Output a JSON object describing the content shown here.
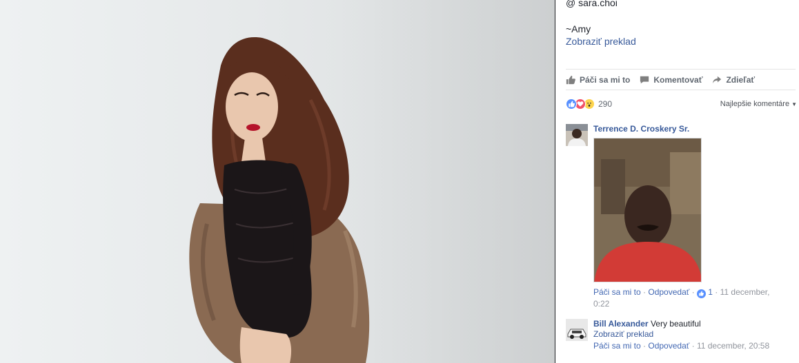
{
  "photo": {
    "icon": "portrait-photo",
    "colors": {
      "backdrop": "#e8ebec",
      "hair": "#5a2e1e",
      "dress": "#1b1618",
      "fur": "#8a6a52",
      "lips": "#b5132a",
      "skin": "#e9c7ae"
    }
  },
  "caption": {
    "mention": "@ sara.choi",
    "signature": "~Amy",
    "translate": "Zobraziť preklad"
  },
  "actions": {
    "like": "Páči sa mi to",
    "comment": "Komentovať",
    "share": "Zdieľať"
  },
  "reactions": {
    "count": "290",
    "types": [
      "like",
      "love",
      "wow"
    ],
    "colors": {
      "like": "#5890ff",
      "love": "#f25268",
      "wow": "#fdd44d"
    },
    "sort_label": "Najlepšie komentáre"
  },
  "comments": [
    {
      "author": "Terrence D. Croskery Sr.",
      "text": "",
      "has_photo": true,
      "like_label": "Páči sa mi to",
      "reply_label": "Odpovedať",
      "likes": "1",
      "date_part1": "11 december,",
      "date_part2": "0:22"
    },
    {
      "author": "Bill Alexander",
      "text": "Very beautiful",
      "translate": "Zobraziť preklad",
      "like_label": "Páči sa mi to",
      "reply_label": "Odpovedať",
      "date": "11 december, 20:58"
    }
  ],
  "separator": " · ",
  "theme": {
    "link": "#365899",
    "muted": "#90949c",
    "accent": "#4267b2"
  }
}
